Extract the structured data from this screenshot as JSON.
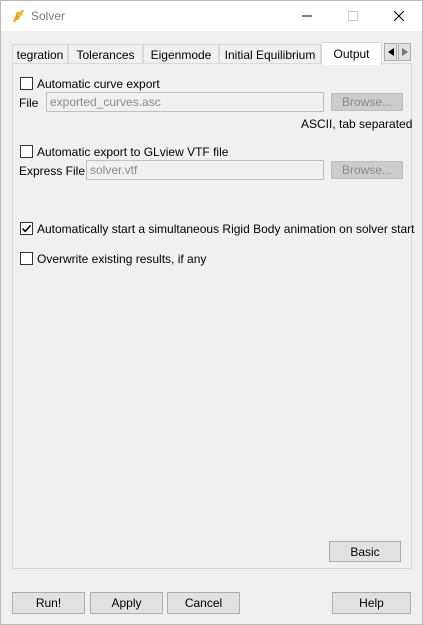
{
  "window": {
    "title": "Solver",
    "controls": {
      "minimize": "minimize",
      "maximize": "maximize",
      "close": "close"
    }
  },
  "tabs": [
    {
      "label": "tegration",
      "active": false
    },
    {
      "label": "Tolerances",
      "active": false
    },
    {
      "label": "Eigenmode",
      "active": false
    },
    {
      "label": "Initial Equilibrium",
      "active": false
    },
    {
      "label": "Output",
      "active": true
    }
  ],
  "output": {
    "curve_export": {
      "label": "Automatic curve export",
      "checked": false,
      "file_label": "File",
      "file_value": "exported_curves.asc",
      "browse_label": "Browse...",
      "format_note": "ASCII, tab separated"
    },
    "vtf_export": {
      "label": "Automatic export to GLview VTF file",
      "checked": false,
      "file_label": "Express File",
      "file_value": "solver.vtf",
      "browse_label": "Browse..."
    },
    "rigid_body_animation": {
      "label": "Automatically start a simultaneous Rigid Body animation on solver start",
      "checked": true
    },
    "overwrite_results": {
      "label": "Overwrite existing results, if any",
      "checked": false
    },
    "basic_label": "Basic"
  },
  "footer": {
    "run_label": "Run!",
    "apply_label": "Apply",
    "cancel_label": "Cancel",
    "help_label": "Help"
  },
  "colors": {
    "window_bg": "#f0f0f0",
    "active_tab_bg": "#ffffff",
    "icon_orange": "#f2a007"
  }
}
